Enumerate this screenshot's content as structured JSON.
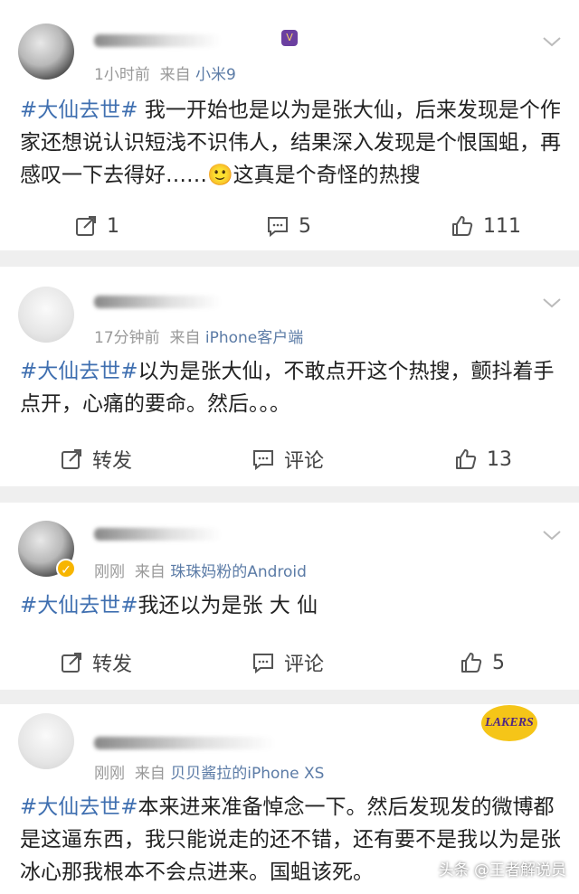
{
  "posts": [
    {
      "meta_time": "1小时前",
      "meta_from": "来自",
      "meta_source": "小米9",
      "topic": "#大仙去世#",
      "text": "我一开始也是以为是张大仙，后来发现是个作家还想说认识短浅不识伟人，结果深入发现是个恨国蛆，再感叹一下去得好……🙂这真是个奇怪的热搜",
      "repost": "1",
      "comment": "5",
      "like": "111"
    },
    {
      "meta_time": "17分钟前",
      "meta_from": "来自",
      "meta_source": "iPhone客户端",
      "topic": "#大仙去世#",
      "text": "以为是张大仙，不敢点开这个热搜，颤抖着手点开，心痛的要命。然后。。。",
      "repost": "转发",
      "comment": "评论",
      "like": "13"
    },
    {
      "meta_time": "刚刚",
      "meta_from": "来自",
      "meta_source": "珠珠妈粉的Android",
      "topic": "#大仙去世#",
      "text": "我还以为是张 大 仙",
      "repost": "转发",
      "comment": "评论",
      "like": "5"
    },
    {
      "meta_time": "刚刚",
      "meta_from": "来自",
      "meta_source": "贝贝酱拉的iPhone XS",
      "topic": "#大仙去世#",
      "text": "本来进来准备悼念一下。然后发现发的微博都是这逼东西，我只能说走的还不错，还有要不是我以为是张冰心那我根本不会点进来。国蛆该死。"
    }
  ],
  "badge": {
    "lakers": "LAKERS"
  },
  "watermark": "头条 @王者解说员",
  "colors": {
    "topic": "#3f6fb0",
    "source": "#5b7ba6",
    "bg": "#efefef"
  }
}
